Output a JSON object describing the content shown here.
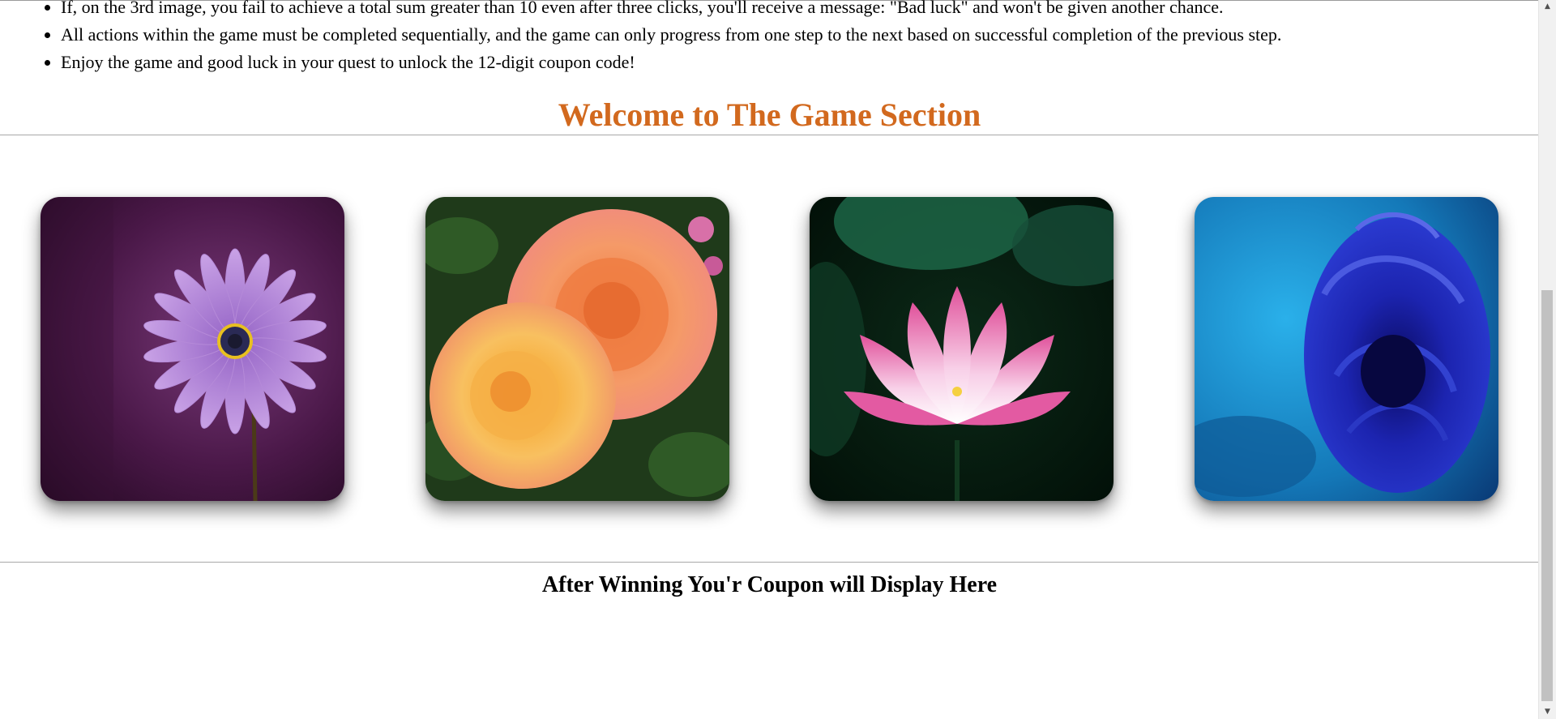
{
  "rules": [
    "If, on the 3rd image, you fail to achieve a total sum greater than 10 even after three clicks, you'll receive a message: \"Bad luck\" and won't be given another chance.",
    "All actions within the game must be completed sequentially, and the game can only progress from one step to the next based on successful completion of the previous step.",
    "Enjoy the game and good luck in your quest to unlock the 12-digit coupon code!"
  ],
  "game": {
    "heading": "Welcome to The Game Section",
    "heading_color": "#d2691e",
    "cards": [
      {
        "icon": "purple-daisy-image"
      },
      {
        "icon": "orange-roses-image"
      },
      {
        "icon": "pink-lotus-image"
      },
      {
        "icon": "blue-rose-image"
      }
    ]
  },
  "coupon": {
    "heading": "After Winning You'r Coupon will Display Here"
  },
  "scrollbar": {
    "up_arrow": "▲",
    "down_arrow": "▼"
  }
}
